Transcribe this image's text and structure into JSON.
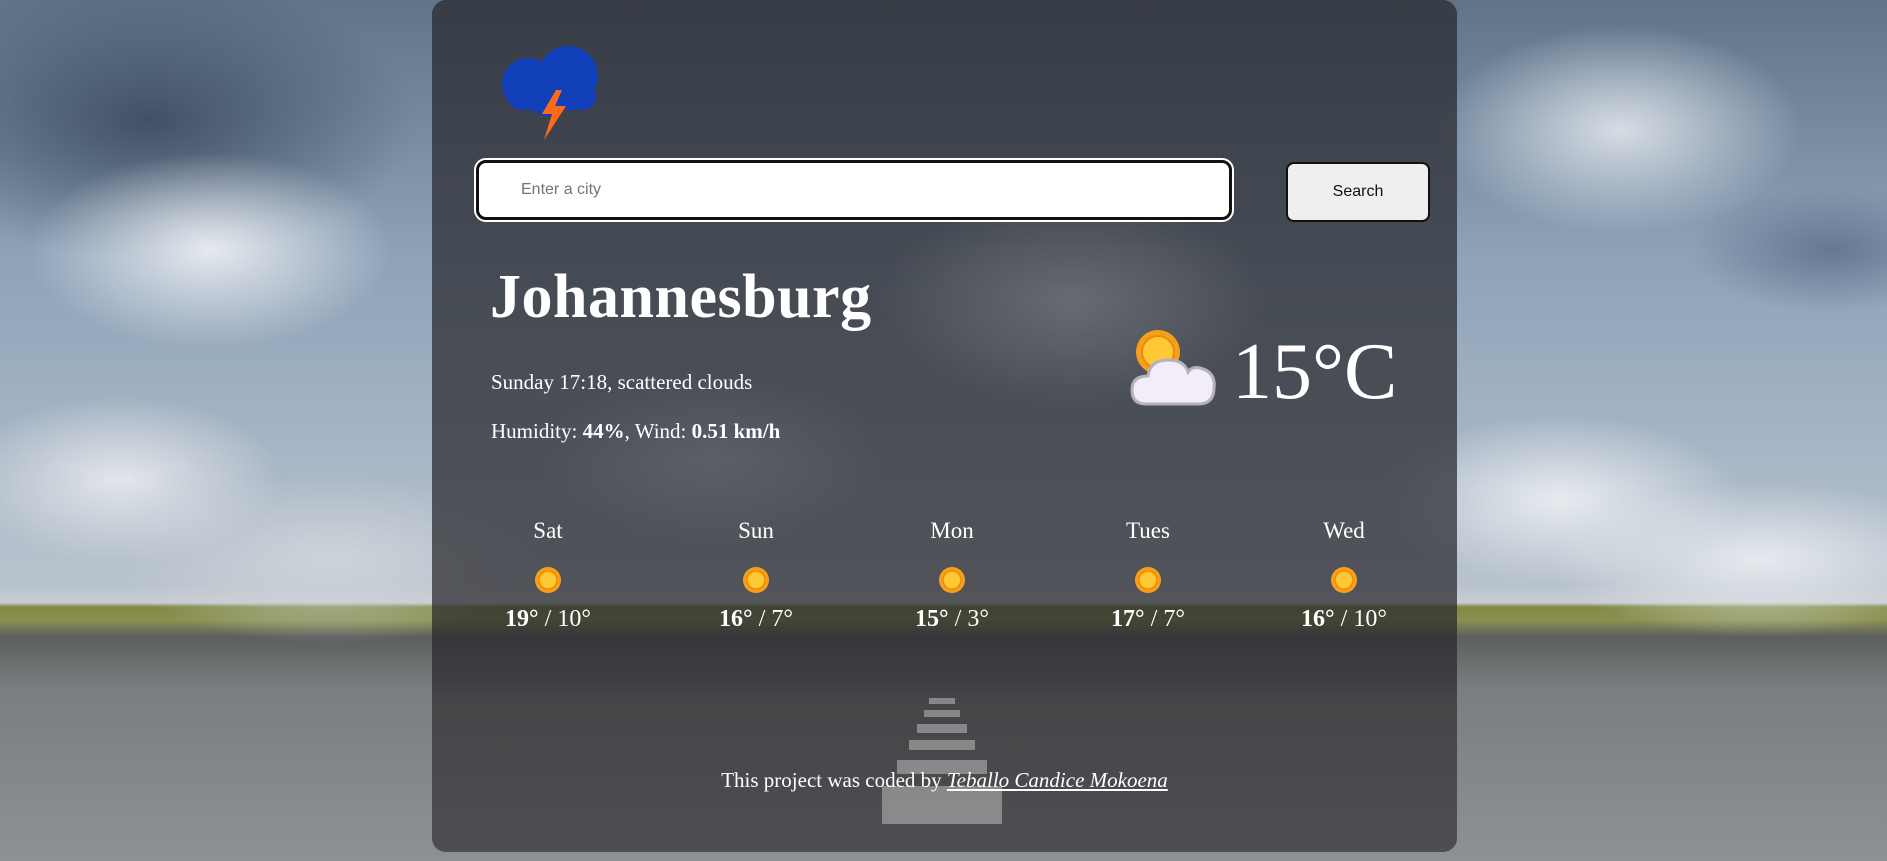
{
  "app": {
    "logo_icon": "storm-cloud-lightning-icon",
    "brand_colors": {
      "cloud": "#1240b8",
      "bolt": "#ff6a1a"
    }
  },
  "search": {
    "placeholder": "Enter a city",
    "value": "",
    "button_label": "Search"
  },
  "current": {
    "city": "Johannesburg",
    "day_time": "Sunday 17:18",
    "description": "scattered clouds",
    "humidity_label": "Humidity:",
    "humidity_value": "44%",
    "wind_label": "Wind:",
    "wind_value": "0.51 km/h",
    "icon": "partly-cloudy-icon",
    "temperature": "15°C"
  },
  "forecast": [
    {
      "day": "Sat",
      "icon": "sun-icon",
      "high": "19°",
      "low": "10°"
    },
    {
      "day": "Sun",
      "icon": "sun-icon",
      "high": "16°",
      "low": "7°"
    },
    {
      "day": "Mon",
      "icon": "sun-icon",
      "high": "15°",
      "low": "3°"
    },
    {
      "day": "Tues",
      "icon": "sun-icon",
      "high": "17°",
      "low": "7°"
    },
    {
      "day": "Wed",
      "icon": "sun-icon",
      "high": "16°",
      "low": "10°"
    }
  ],
  "footer": {
    "text": "This project was coded by",
    "author_link": "Teballo Candice Mokoena"
  }
}
